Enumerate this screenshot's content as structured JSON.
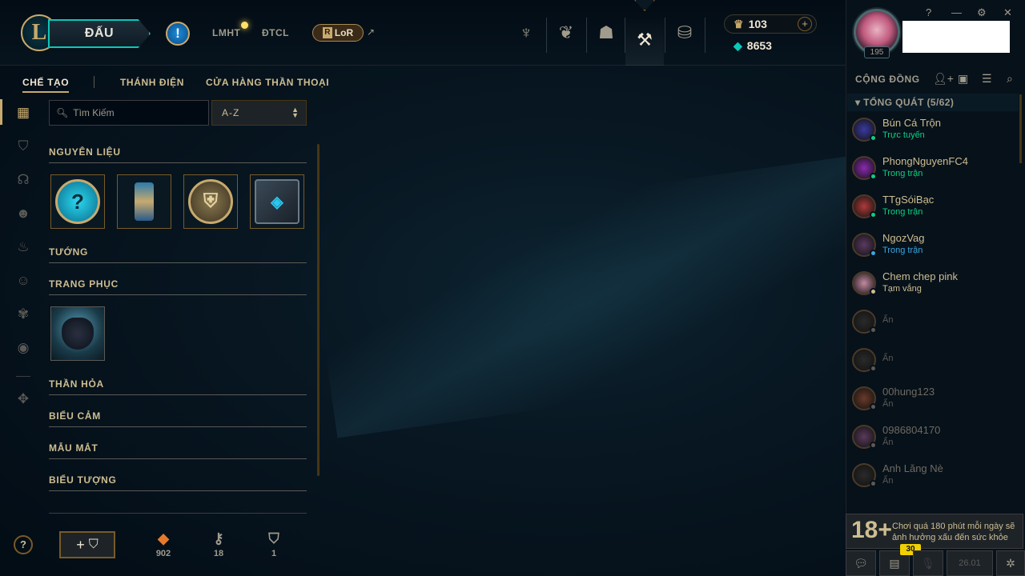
{
  "topbar": {
    "play_label": "ĐẤU",
    "alert_icon": "!",
    "link_lmht": "LMHT",
    "link_dtcl": "ĐTCL",
    "lor_label": "LoR",
    "rp_amount": "103",
    "be_amount": "8653",
    "nav_icons": [
      "trophy-icon",
      "ranked-icon",
      "tft-icon",
      "collection-icon",
      "store-icon"
    ]
  },
  "subnav": {
    "tab_craft": "CHẾ TẠO",
    "tab_sanctum": "THÁNH ĐIỆN",
    "tab_mythic": "CỬA HÀNG THẦN THOẠI"
  },
  "search": {
    "placeholder": "Tìm Kiếm",
    "sort_value": "A-Z"
  },
  "sections": {
    "materials": "NGUYÊN LIỆU",
    "champions": "TƯỚNG",
    "skins": "TRANG PHỤC",
    "ward": "THẦN HỎA",
    "emotes": "BIỂU CẢM",
    "eyes": "MẪU MẮT",
    "icons": "BIỂU TƯỢNG"
  },
  "currencies": {
    "orange_essence": "902",
    "keys": "18",
    "chests": "1"
  },
  "profile": {
    "level": "195"
  },
  "social": {
    "header": "CỘNG ĐỒNG",
    "group": "TỔNG QUÁT (5/62)",
    "friends": [
      {
        "name": "Bún Cá Trộn",
        "status": "Trực tuyến",
        "status_color": "#0acf83",
        "avatar": "#3a3aa0"
      },
      {
        "name": "PhongNguyenFC4",
        "status": "Trong trận",
        "status_color": "#0acf83",
        "avatar": "#8a2ab0"
      },
      {
        "name": "TTgSóiBạc",
        "status": "Trong trận",
        "status_color": "#0acf83",
        "avatar": "#b03a3a"
      },
      {
        "name": "NgozVag",
        "status": "Trong trận",
        "status_color": "#3aa6e0",
        "avatar": "#5a3a60"
      },
      {
        "name": "Chem chep pink",
        "status": "Tạm vắng",
        "status_color": "#cdbe91",
        "avatar": "#c48aa0"
      },
      {
        "name": "",
        "status": "Ẩn",
        "status_color": "#5b5a56",
        "avatar": "#2a2a2a"
      },
      {
        "name": "",
        "status": "Ẩn",
        "status_color": "#5b5a56",
        "avatar": "#2a2a2a"
      },
      {
        "name": "00hung123",
        "status": "Ẩn",
        "status_color": "#5b5a56",
        "avatar": "#6a3a2a"
      },
      {
        "name": "0986804170",
        "status": "Ẩn",
        "status_color": "#5b5a56",
        "avatar": "#5a3a5a"
      },
      {
        "name": "Anh Lăng Nè",
        "status": "Ẩn",
        "status_color": "#5b5a56",
        "avatar": "#2a2a2a"
      }
    ]
  },
  "warning": {
    "age": "18+",
    "text": "Chơi quá 180 phút mỗi ngày sẽ ảnh hưởng xấu đến sức khỏe"
  },
  "footer": {
    "badge": "30",
    "version": "26.01"
  }
}
